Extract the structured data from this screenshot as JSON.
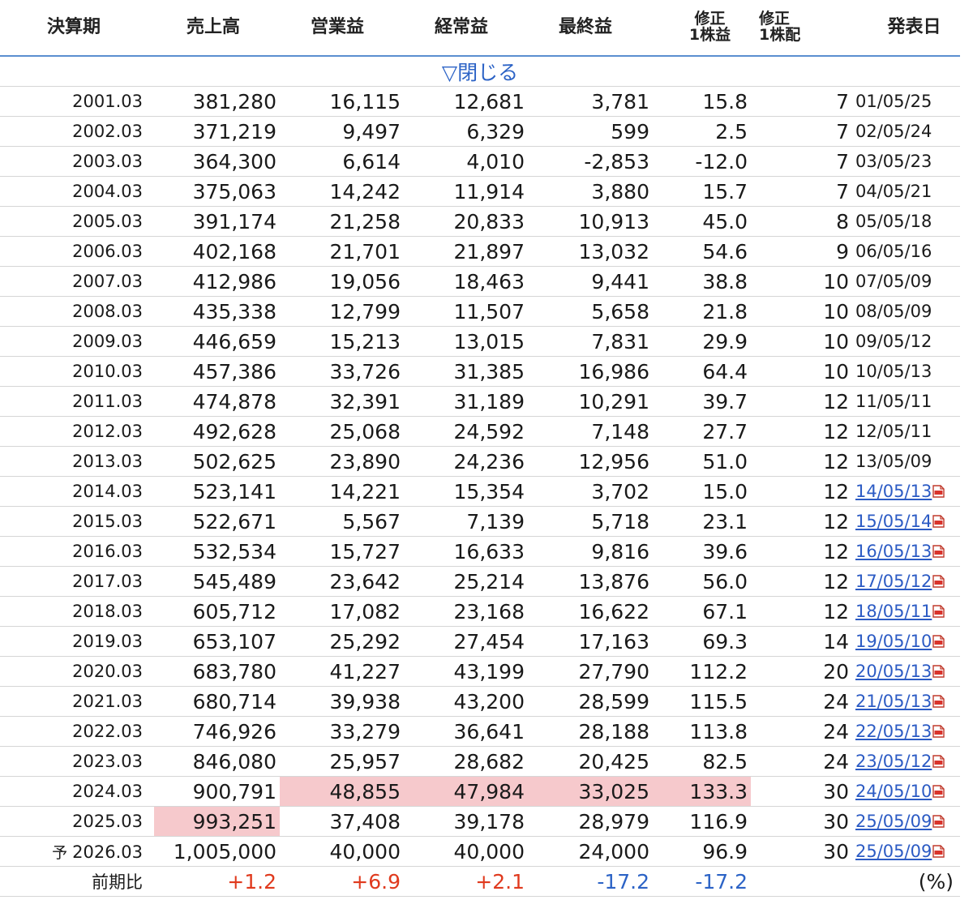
{
  "headers": {
    "period": "決算期",
    "sales": "売上高",
    "op_profit": "営業益",
    "ord_profit": "経常益",
    "net_profit": "最終益",
    "eps_top": "修正",
    "eps_bottom": "1株益",
    "dps_top": "修正",
    "dps_bottom": "1株配",
    "announce": "発表日"
  },
  "toggle_label": "▽閉じる",
  "rows": [
    {
      "period": "2001.03",
      "sales": "381,280",
      "op": "16,115",
      "ord": "12,681",
      "net": "3,781",
      "eps": "15.8",
      "dps": "7",
      "date": "01/05/25",
      "link": false
    },
    {
      "period": "2002.03",
      "sales": "371,219",
      "op": "9,497",
      "ord": "6,329",
      "net": "599",
      "eps": "2.5",
      "dps": "7",
      "date": "02/05/24",
      "link": false
    },
    {
      "period": "2003.03",
      "sales": "364,300",
      "op": "6,614",
      "ord": "4,010",
      "net": "-2,853",
      "eps": "-12.0",
      "dps": "7",
      "date": "03/05/23",
      "link": false
    },
    {
      "period": "2004.03",
      "sales": "375,063",
      "op": "14,242",
      "ord": "11,914",
      "net": "3,880",
      "eps": "15.7",
      "dps": "7",
      "date": "04/05/21",
      "link": false
    },
    {
      "period": "2005.03",
      "sales": "391,174",
      "op": "21,258",
      "ord": "20,833",
      "net": "10,913",
      "eps": "45.0",
      "dps": "8",
      "date": "05/05/18",
      "link": false
    },
    {
      "period": "2006.03",
      "sales": "402,168",
      "op": "21,701",
      "ord": "21,897",
      "net": "13,032",
      "eps": "54.6",
      "dps": "9",
      "date": "06/05/16",
      "link": false
    },
    {
      "period": "2007.03",
      "sales": "412,986",
      "op": "19,056",
      "ord": "18,463",
      "net": "9,441",
      "eps": "38.8",
      "dps": "10",
      "date": "07/05/09",
      "link": false
    },
    {
      "period": "2008.03",
      "sales": "435,338",
      "op": "12,799",
      "ord": "11,507",
      "net": "5,658",
      "eps": "21.8",
      "dps": "10",
      "date": "08/05/09",
      "link": false
    },
    {
      "period": "2009.03",
      "sales": "446,659",
      "op": "15,213",
      "ord": "13,015",
      "net": "7,831",
      "eps": "29.9",
      "dps": "10",
      "date": "09/05/12",
      "link": false
    },
    {
      "period": "2010.03",
      "sales": "457,386",
      "op": "33,726",
      "ord": "31,385",
      "net": "16,986",
      "eps": "64.4",
      "dps": "10",
      "date": "10/05/13",
      "link": false
    },
    {
      "period": "2011.03",
      "sales": "474,878",
      "op": "32,391",
      "ord": "31,189",
      "net": "10,291",
      "eps": "39.7",
      "dps": "12",
      "date": "11/05/11",
      "link": false
    },
    {
      "period": "2012.03",
      "sales": "492,628",
      "op": "25,068",
      "ord": "24,592",
      "net": "7,148",
      "eps": "27.7",
      "dps": "12",
      "date": "12/05/11",
      "link": false
    },
    {
      "period": "2013.03",
      "sales": "502,625",
      "op": "23,890",
      "ord": "24,236",
      "net": "12,956",
      "eps": "51.0",
      "dps": "12",
      "date": "13/05/09",
      "link": false
    },
    {
      "period": "2014.03",
      "sales": "523,141",
      "op": "14,221",
      "ord": "15,354",
      "net": "3,702",
      "eps": "15.0",
      "dps": "12",
      "date": "14/05/13",
      "link": true
    },
    {
      "period": "2015.03",
      "sales": "522,671",
      "op": "5,567",
      "ord": "7,139",
      "net": "5,718",
      "eps": "23.1",
      "dps": "12",
      "date": "15/05/14",
      "link": true
    },
    {
      "period": "2016.03",
      "sales": "532,534",
      "op": "15,727",
      "ord": "16,633",
      "net": "9,816",
      "eps": "39.6",
      "dps": "12",
      "date": "16/05/13",
      "link": true
    },
    {
      "period": "2017.03",
      "sales": "545,489",
      "op": "23,642",
      "ord": "25,214",
      "net": "13,876",
      "eps": "56.0",
      "dps": "12",
      "date": "17/05/12",
      "link": true
    },
    {
      "period": "2018.03",
      "sales": "605,712",
      "op": "17,082",
      "ord": "23,168",
      "net": "16,622",
      "eps": "67.1",
      "dps": "12",
      "date": "18/05/11",
      "link": true
    },
    {
      "period": "2019.03",
      "sales": "653,107",
      "op": "25,292",
      "ord": "27,454",
      "net": "17,163",
      "eps": "69.3",
      "dps": "14",
      "date": "19/05/10",
      "link": true
    },
    {
      "period": "2020.03",
      "sales": "683,780",
      "op": "41,227",
      "ord": "43,199",
      "net": "27,790",
      "eps": "112.2",
      "dps": "20",
      "date": "20/05/13",
      "link": true
    },
    {
      "period": "2021.03",
      "sales": "680,714",
      "op": "39,938",
      "ord": "43,200",
      "net": "28,599",
      "eps": "115.5",
      "dps": "24",
      "date": "21/05/13",
      "link": true
    },
    {
      "period": "2022.03",
      "sales": "746,926",
      "op": "33,279",
      "ord": "36,641",
      "net": "28,188",
      "eps": "113.8",
      "dps": "24",
      "date": "22/05/13",
      "link": true
    },
    {
      "period": "2023.03",
      "sales": "846,080",
      "op": "25,957",
      "ord": "28,682",
      "net": "20,425",
      "eps": "82.5",
      "dps": "24",
      "date": "23/05/12",
      "link": true
    },
    {
      "period": "2024.03",
      "sales": "900,791",
      "op": "48,855",
      "ord": "47,984",
      "net": "33,025",
      "eps": "133.3",
      "dps": "30",
      "date": "24/05/10",
      "link": true,
      "hl": [
        "op",
        "ord",
        "net",
        "eps"
      ]
    },
    {
      "period": "2025.03",
      "sales": "993,251",
      "op": "37,408",
      "ord": "39,178",
      "net": "28,979",
      "eps": "116.9",
      "dps": "30",
      "date": "25/05/09",
      "link": true,
      "hl": [
        "sales"
      ]
    },
    {
      "forecast_mark": "予",
      "period": "2026.03",
      "sales": "1,005,000",
      "op": "40,000",
      "ord": "40,000",
      "net": "24,000",
      "eps": "96.9",
      "dps": "30",
      "date": "25/05/09",
      "link": true
    }
  ],
  "comparison": {
    "label": "前期比",
    "sales": "+1.2",
    "op": "+6.9",
    "ord": "+2.1",
    "net": "-17.2",
    "eps": "-17.2",
    "unit": "(%)"
  },
  "colors": {
    "highlight": "#f6c9cc",
    "positive": "#e03a1e",
    "negative": "#2c63c6",
    "link": "#2c5bc4",
    "header_rule": "#5b8fd0"
  },
  "icons": {
    "pdf": "pdf-file-icon"
  }
}
